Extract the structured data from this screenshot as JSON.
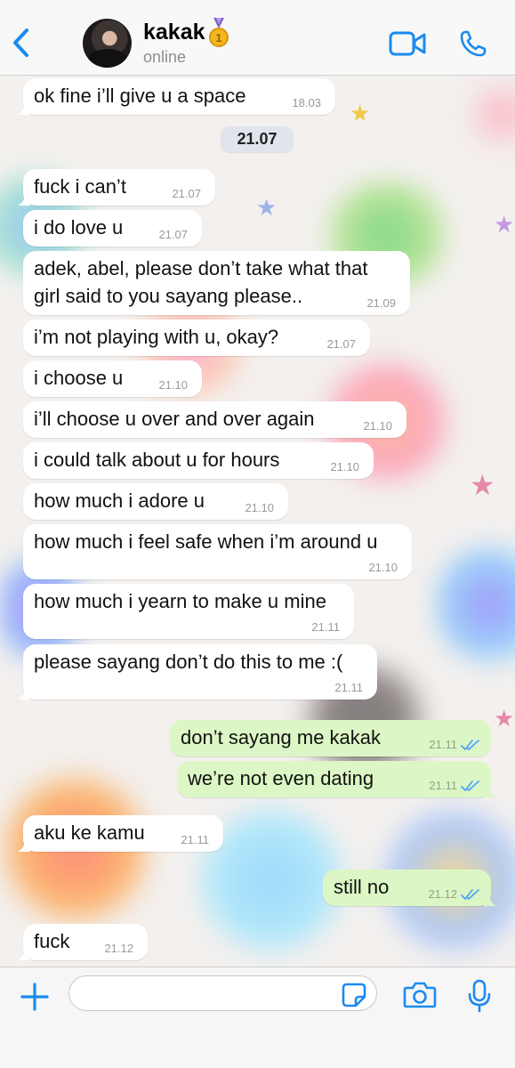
{
  "header": {
    "contact_name": "kakak",
    "status": "online"
  },
  "colors": {
    "accent": "#1a8bf0",
    "incoming_bubble": "#ffffff",
    "outgoing_bubble": "#dcf7c5",
    "read_ticks": "#4fa3f7"
  },
  "icons": {
    "back": "chevron-left-icon",
    "badge": "medal-icon",
    "video": "video-camera-icon",
    "call": "phone-icon",
    "attach": "plus-icon",
    "sticker": "sticker-icon",
    "camera": "camera-icon",
    "mic": "microphone-icon"
  },
  "date_separator": "21.07",
  "messages": [
    {
      "text": "ok fine i’ll give u a space",
      "time": "18.03",
      "dir": "in"
    },
    {
      "text": "fuck i can’t",
      "time": "21.07",
      "dir": "in"
    },
    {
      "text": "i do love u",
      "time": "21.07",
      "dir": "in"
    },
    {
      "text": "adek, abel, please don’t take what that\ngirl said to you sayang please..",
      "time": "21.09",
      "dir": "in"
    },
    {
      "text": "i’m not playing with u, okay?",
      "time": "21.07",
      "dir": "in"
    },
    {
      "text": "i choose u",
      "time": "21.10",
      "dir": "in"
    },
    {
      "text": "i’ll choose u over and over again",
      "time": "21.10",
      "dir": "in"
    },
    {
      "text": "i could talk about u for hours",
      "time": "21.10",
      "dir": "in"
    },
    {
      "text": "how much i adore u",
      "time": "21.10",
      "dir": "in"
    },
    {
      "text": "how much i feel safe when i’m around u",
      "time": "21.10",
      "dir": "in"
    },
    {
      "text": "how much i yearn to make u mine",
      "time": "21.11",
      "dir": "in"
    },
    {
      "text": "please sayang don’t do this to me :(",
      "time": "21.11",
      "dir": "in"
    },
    {
      "text": "don’t sayang me kakak",
      "time": "21.11",
      "dir": "out"
    },
    {
      "text": "we’re not even dating",
      "time": "21.11",
      "dir": "out"
    },
    {
      "text": "aku ke kamu",
      "time": "21.11",
      "dir": "in"
    },
    {
      "text": "still no",
      "time": "21.12",
      "dir": "out"
    },
    {
      "text": "fuck",
      "time": "21.12",
      "dir": "in"
    }
  ]
}
